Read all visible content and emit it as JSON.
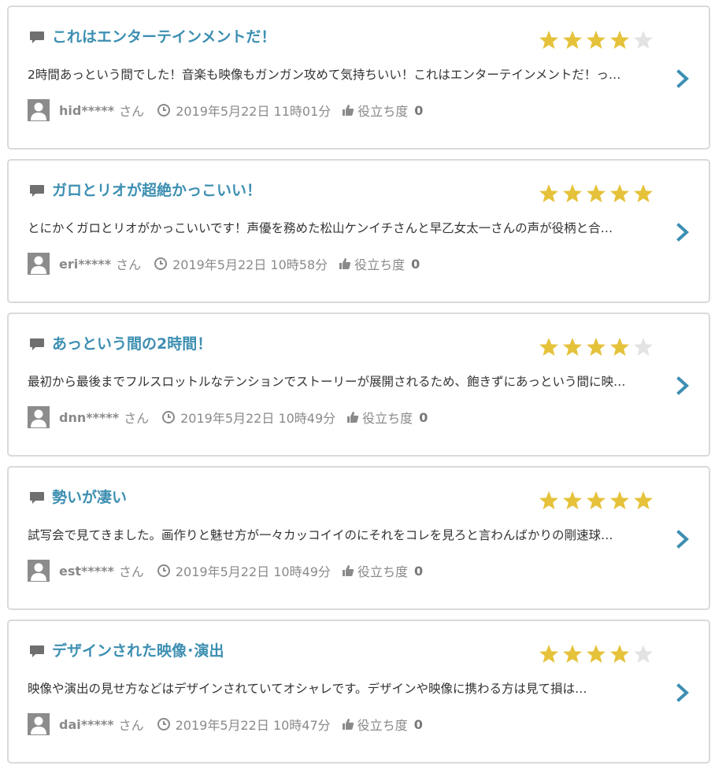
{
  "reviews": [
    {
      "title": "これはエンターテインメントだ！",
      "rating": 4,
      "excerpt": "2時間あっという間でした！音楽も映像もガンガン攻めて気持ちいい！これはエンターテインメントだ！っ…",
      "username": "hid*****",
      "honorific": "さん",
      "date": "2019年5月22日 11時01分",
      "helpful_label": "役立ち度",
      "helpful_count": "0"
    },
    {
      "title": "ガロとリオが超絶かっこいい！",
      "rating": 5,
      "excerpt": "とにかくガロとリオがかっこいいです！声優を務めた松山ケンイチさんと早乙女太一さんの声が役柄と合…",
      "username": "eri*****",
      "honorific": "さん",
      "date": "2019年5月22日 10時58分",
      "helpful_label": "役立ち度",
      "helpful_count": "0"
    },
    {
      "title": "あっという間の2時間！",
      "rating": 4,
      "excerpt": "最初から最後までフルスロットルなテンションでストーリーが展開されるため、飽きずにあっという間に映…",
      "username": "dnn*****",
      "honorific": "さん",
      "date": "2019年5月22日 10時49分",
      "helpful_label": "役立ち度",
      "helpful_count": "0"
    },
    {
      "title": "勢いが凄い",
      "rating": 5,
      "excerpt": "試写会で見てきました。画作りと魅せ方が一々カッコイイのにそれをコレを見ろと言わんばかりの剛速球…",
      "username": "est*****",
      "honorific": "さん",
      "date": "2019年5月22日 10時49分",
      "helpful_label": "役立ち度",
      "helpful_count": "0"
    },
    {
      "title": "デザインされた映像･演出",
      "rating": 4,
      "excerpt": "映像や演出の見せ方などはデザインされていてオシャレです。デザインや映像に携わる方は見て損は…",
      "username": "dai*****",
      "honorific": "さん",
      "date": "2019年5月22日 10時47分",
      "helpful_label": "役立ち度",
      "helpful_count": "0"
    }
  ],
  "icons": {
    "comment": "comment-icon",
    "star": "star-icon",
    "chevron": "chevron-right-icon",
    "avatar": "user-avatar-icon",
    "clock": "clock-icon",
    "thumb": "thumbs-up-icon"
  },
  "colors": {
    "title": "#3d8fb2",
    "star_filled": "#e5c23a",
    "star_empty": "#e3e3e3",
    "chevron": "#3d8fb2",
    "meta_text": "#8a8a8a",
    "border": "#dadada"
  },
  "max_rating": 5
}
